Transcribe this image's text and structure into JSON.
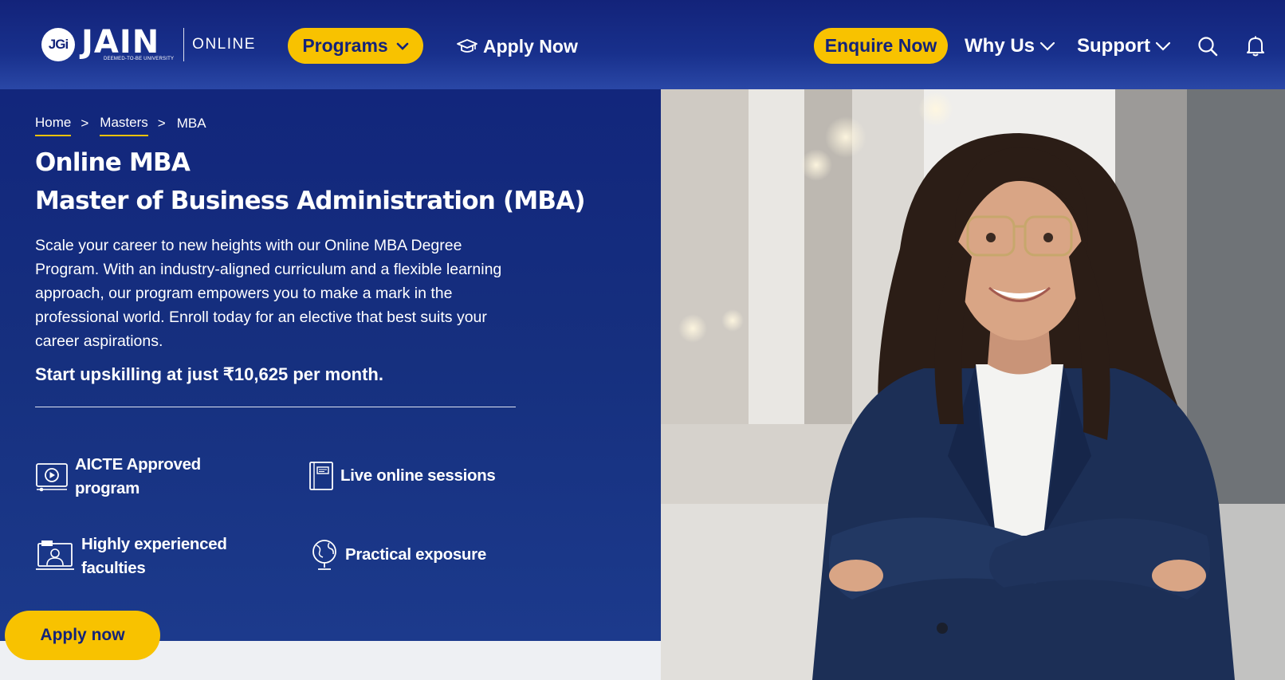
{
  "header": {
    "logo_mark": "JGi",
    "logo_word": "JAIN",
    "logo_sub": "DEEMED-TO-BE UNIVERSITY",
    "logo_online": "ONLINE",
    "programs_label": "Programs",
    "apply_label": "Apply Now",
    "enquire_label": "Enquire Now",
    "why_us_label": "Why Us",
    "support_label": "Support"
  },
  "breadcrumb": {
    "items": [
      "Home",
      "Masters",
      "MBA"
    ],
    "separator": ">"
  },
  "hero": {
    "title_line1": "Online MBA",
    "title_line2": "Master of Business Administration (MBA)",
    "description": "Scale your career to new heights with our Online MBA Degree Program. With an industry-aligned curriculum and a flexible learning approach, our program empowers you to make a mark in the professional world. Enroll today for an elective that best suits your career aspirations.",
    "price_line": "Start upskilling at just ₹10,625 per month.",
    "features": [
      {
        "label": "AICTE Approved program",
        "icon": "video-screen-icon"
      },
      {
        "label": "Live online sessions",
        "icon": "notebook-icon"
      },
      {
        "label": "Highly experienced faculties",
        "icon": "teacher-screen-icon"
      },
      {
        "label": "Practical exposure",
        "icon": "globe-icon"
      }
    ],
    "cta_label": "Apply now"
  },
  "colors": {
    "brand_navy": "#13237a",
    "accent_yellow": "#f8c200"
  }
}
